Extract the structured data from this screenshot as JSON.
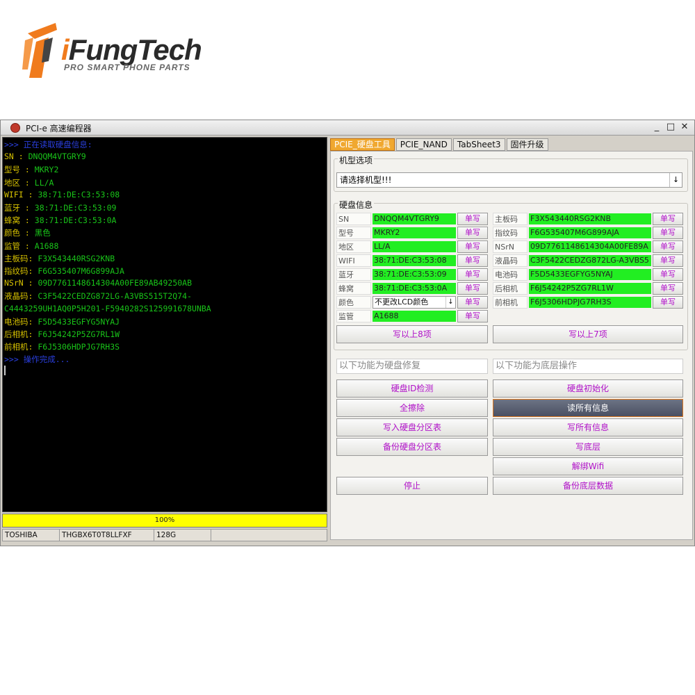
{
  "logo": {
    "brand_prefix": "i",
    "brand_main": "FungTech",
    "tagline": "PRO SMART PHONE PARTS"
  },
  "window": {
    "title": "PCI-e 高速编程器",
    "minimize": "_",
    "maximize": "□",
    "close": "✕"
  },
  "console": {
    "lines": [
      {
        "text": ">>> 正在读取硬盘信息:",
        "color": "blue"
      },
      {
        "label": "    SN    : ",
        "value": "DNQQM4VTGRY9"
      },
      {
        "label": "    型号  : ",
        "value": "MKRY2"
      },
      {
        "label": "    地区  : ",
        "value": "LL/A"
      },
      {
        "label": "    WIFI  : ",
        "value": "38:71:DE:C3:53:08"
      },
      {
        "label": "    蓝牙  : ",
        "value": "38:71:DE:C3:53:09"
      },
      {
        "label": "    蜂窝  : ",
        "value": "38:71:DE:C3:53:0A"
      },
      {
        "label": "    颜色  : ",
        "value": "黑色"
      },
      {
        "label": "    监管  : ",
        "value": "A1688"
      },
      {
        "label": "    主板码: ",
        "value": "F3X543440RSG2KNB"
      },
      {
        "label": "    指纹码: ",
        "value": "F6G535407M6G899AJA"
      },
      {
        "label": "    NSrN  : ",
        "value": "09D7761148614304A00FE89AB49250AB"
      },
      {
        "label": "    液晶码: ",
        "value": "C3F5422CEDZG872LG-A3VBS515T2Q74-"
      },
      {
        "label": "",
        "value": "C4443259UH1AQ0P5H201-F5940282S125991678UNBA"
      },
      {
        "label": "    电池码: ",
        "value": "F5D5433EGFYG5NYAJ"
      },
      {
        "label": "    后相机: ",
        "value": "F6J54242P5ZG7RL1W"
      },
      {
        "label": "    前相机: ",
        "value": "F6J5306HDPJG7RH3S"
      },
      {
        "text": ">>> 操作完成...",
        "color": "blue"
      }
    ]
  },
  "progress": {
    "percent": 100,
    "label": "100%"
  },
  "statusbar": {
    "vendor": "TOSHIBA",
    "model": "THGBX6T0T8LLFXF",
    "capacity": "128G",
    "extra": ""
  },
  "tabs": [
    {
      "label": "PCIE_硬盘工具",
      "active": true
    },
    {
      "label": "PCIE_NAND",
      "active": false
    },
    {
      "label": "TabSheet3",
      "active": false
    },
    {
      "label": "固件升级",
      "active": false
    }
  ],
  "model_select": {
    "group_label": "机型选项",
    "value": "请选择机型!!!",
    "arrow": "↓"
  },
  "disk_info": {
    "group_label": "硬盘信息",
    "write_label": "单写",
    "left": [
      {
        "label": "SN",
        "value": "DNQQM4VTGRY9"
      },
      {
        "label": "型号",
        "value": "MKRY2"
      },
      {
        "label": "地区",
        "value": "LL/A"
      },
      {
        "label": "WIFI",
        "value": "38:71:DE:C3:53:08"
      },
      {
        "label": "蓝牙",
        "value": "38:71:DE:C3:53:09"
      },
      {
        "label": "蜂窝",
        "value": "38:71:DE:C3:53:0A"
      },
      {
        "label": "颜色",
        "value": "不更改LCD颜色",
        "select": true,
        "arrow": "↓"
      },
      {
        "label": "监管",
        "value": "A1688"
      }
    ],
    "right": [
      {
        "label": "主板码",
        "value": "F3X543440RSG2KNB"
      },
      {
        "label": "指纹码",
        "value": "F6G535407M6G899AJA"
      },
      {
        "label": "NSrN",
        "value": "09D7761148614304A00FE89A"
      },
      {
        "label": "液晶码",
        "value": "C3F5422CEDZG872LG-A3VBS5"
      },
      {
        "label": "电池码",
        "value": "F5D5433EGFYG5NYAJ"
      },
      {
        "label": "后相机",
        "value": "F6J54242P5ZG7RL1W"
      },
      {
        "label": "前相机",
        "value": "F6J5306HDPJG7RH3S"
      }
    ],
    "write_left_all": "写以上8项",
    "write_right_all": "写以上7项"
  },
  "repair": {
    "left_header": "以下功能为硬盘修复",
    "right_header": "以下功能为底层操作",
    "left_buttons": [
      "硬盘ID检测",
      "全擦除",
      "写入硬盘分区表",
      "备份硬盘分区表"
    ],
    "right_buttons": [
      "硬盘初始化",
      "读所有信息",
      "写所有信息",
      "写底层",
      "解绑Wifi"
    ],
    "selected_button": "读所有信息",
    "stop": "停止",
    "backup_low": "备份底层数据"
  },
  "colors": {
    "console_bg": "#000000",
    "value_green": "#22ee22",
    "button_text": "#b010c8",
    "progress_yellow": "#ffff00",
    "tab_active": "#f0a830"
  }
}
